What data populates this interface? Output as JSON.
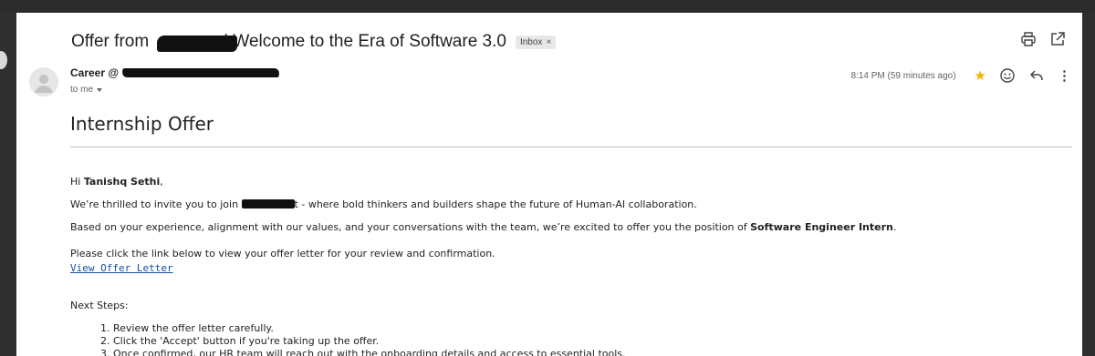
{
  "email": {
    "subject_prefix": "Offer from",
    "subject_suffix": "| Welcome to the Era of Software 3.0",
    "label_chip": "Inbox",
    "label_close": "×",
    "sender_name": "Career @",
    "to_line": "to me",
    "time": "8:14 PM (59 minutes ago)"
  },
  "icons": {
    "print": "print-icon",
    "open_new": "open-in-new-window-icon",
    "star": "star-icon",
    "emoji": "emoji-reaction-icon",
    "reply": "reply-icon",
    "more": "more-vertical-icon",
    "avatar": "default-avatar-icon"
  },
  "body": {
    "heading": "Internship Offer",
    "greeting_prefix": "Hi",
    "greeting_name": "Tanishq Sethi",
    "greeting_suffix": ",",
    "line1_prefix": "We’re thrilled to invite you to join",
    "line1_suffix": "t - where bold thinkers and builders shape the future of Human-AI collaboration.",
    "line2_prefix": "Based on your experience, alignment with our values, and your conversations with the team, we’re excited to offer you the position of",
    "line2_role": "Software Engineer Intern",
    "line2_suffix": ".",
    "line3": "Please click the link below to view your offer letter for your review and confirmation.",
    "link": "View Offer Letter",
    "next_steps_label": "Next Steps:",
    "steps": [
      "1. Review the offer letter carefully.",
      "2. Click the 'Accept' button if you're taking up the offer.",
      "3. Once confirmed, our HR team will reach out with the onboarding details and access to essential tools."
    ]
  },
  "colors": {
    "star": "#f4b400",
    "link": "#1a4ea0",
    "redaction": "#111111"
  }
}
